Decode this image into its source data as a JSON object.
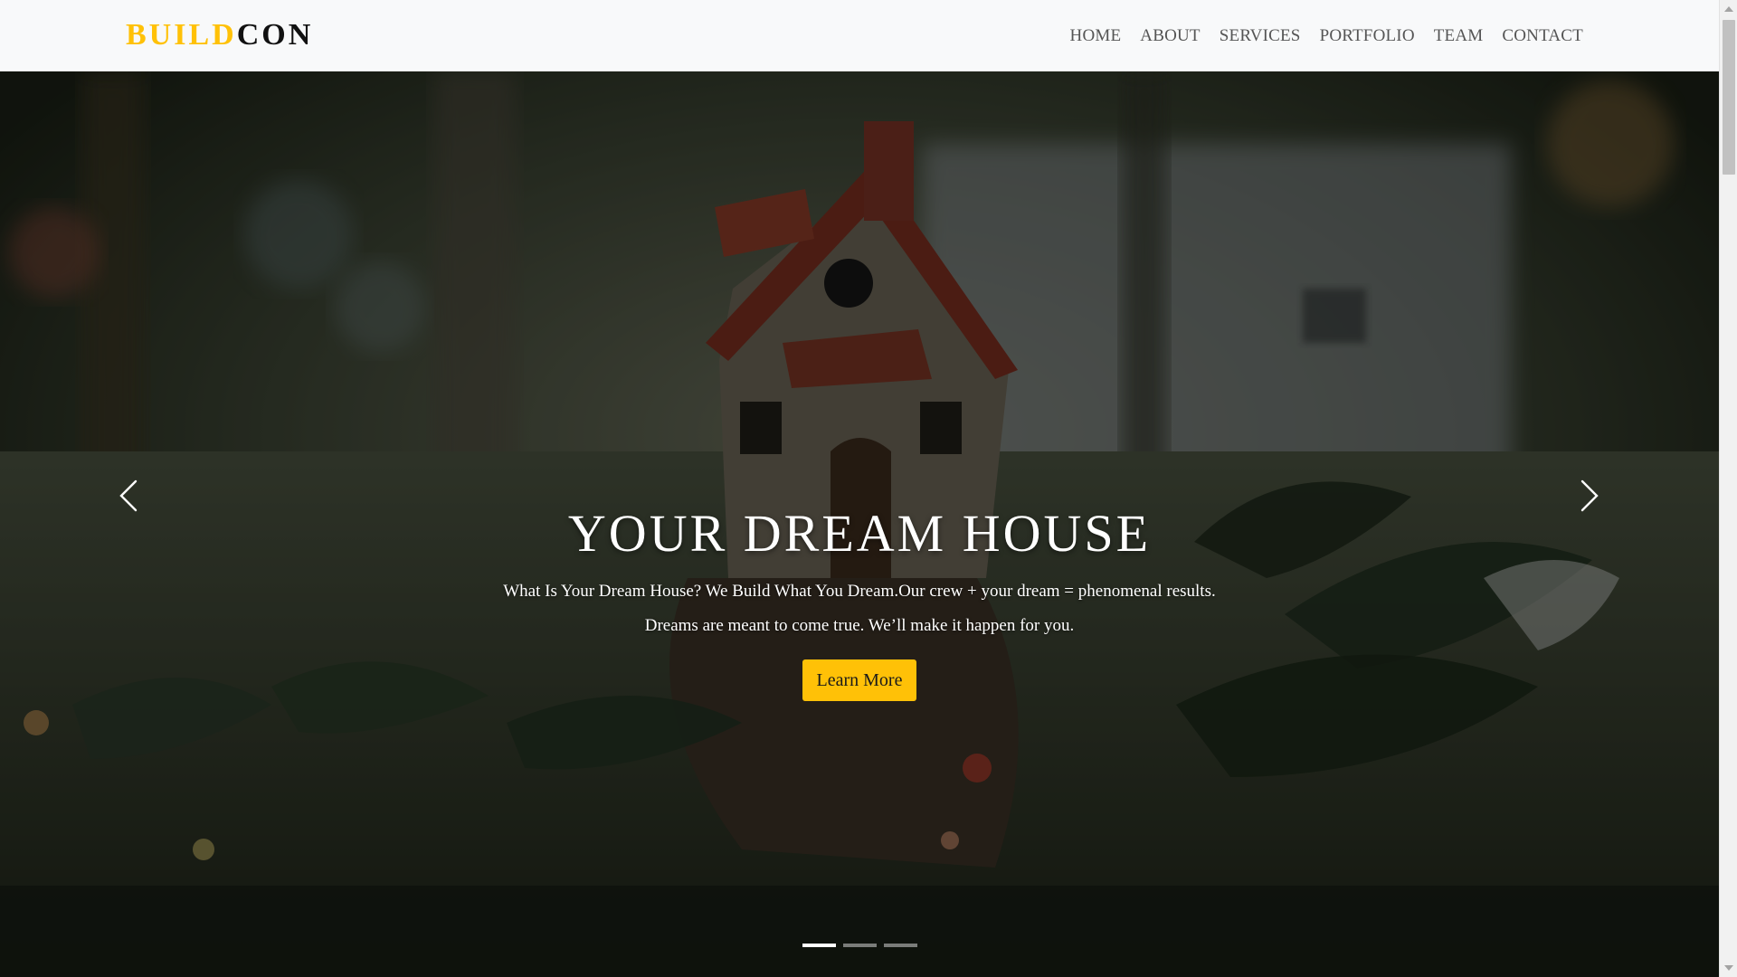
{
  "brand": {
    "accent": "BUILD",
    "rest": "CON"
  },
  "nav": {
    "items": [
      {
        "label": "HOME"
      },
      {
        "label": "ABOUT"
      },
      {
        "label": "SERVICES"
      },
      {
        "label": "PORTFOLIO"
      },
      {
        "label": "TEAM"
      },
      {
        "label": "CONTACT"
      }
    ]
  },
  "hero": {
    "title": "YOUR DREAM HOUSE",
    "text": "What Is Your Dream House? We Build What You Dream.Our crew + your dream = phenomenal results. Dreams are meant to come true. We’ll make it happen for you.",
    "button_label": "Learn More",
    "prev_icon": "chevron-left-icon",
    "next_icon": "chevron-right-icon",
    "slides_count": 3,
    "active_slide": 1
  },
  "colors": {
    "accent": "#ffc107",
    "nav_bg": "#f8f9fa",
    "nav_text": "#555555",
    "brand_dark": "#111111"
  }
}
